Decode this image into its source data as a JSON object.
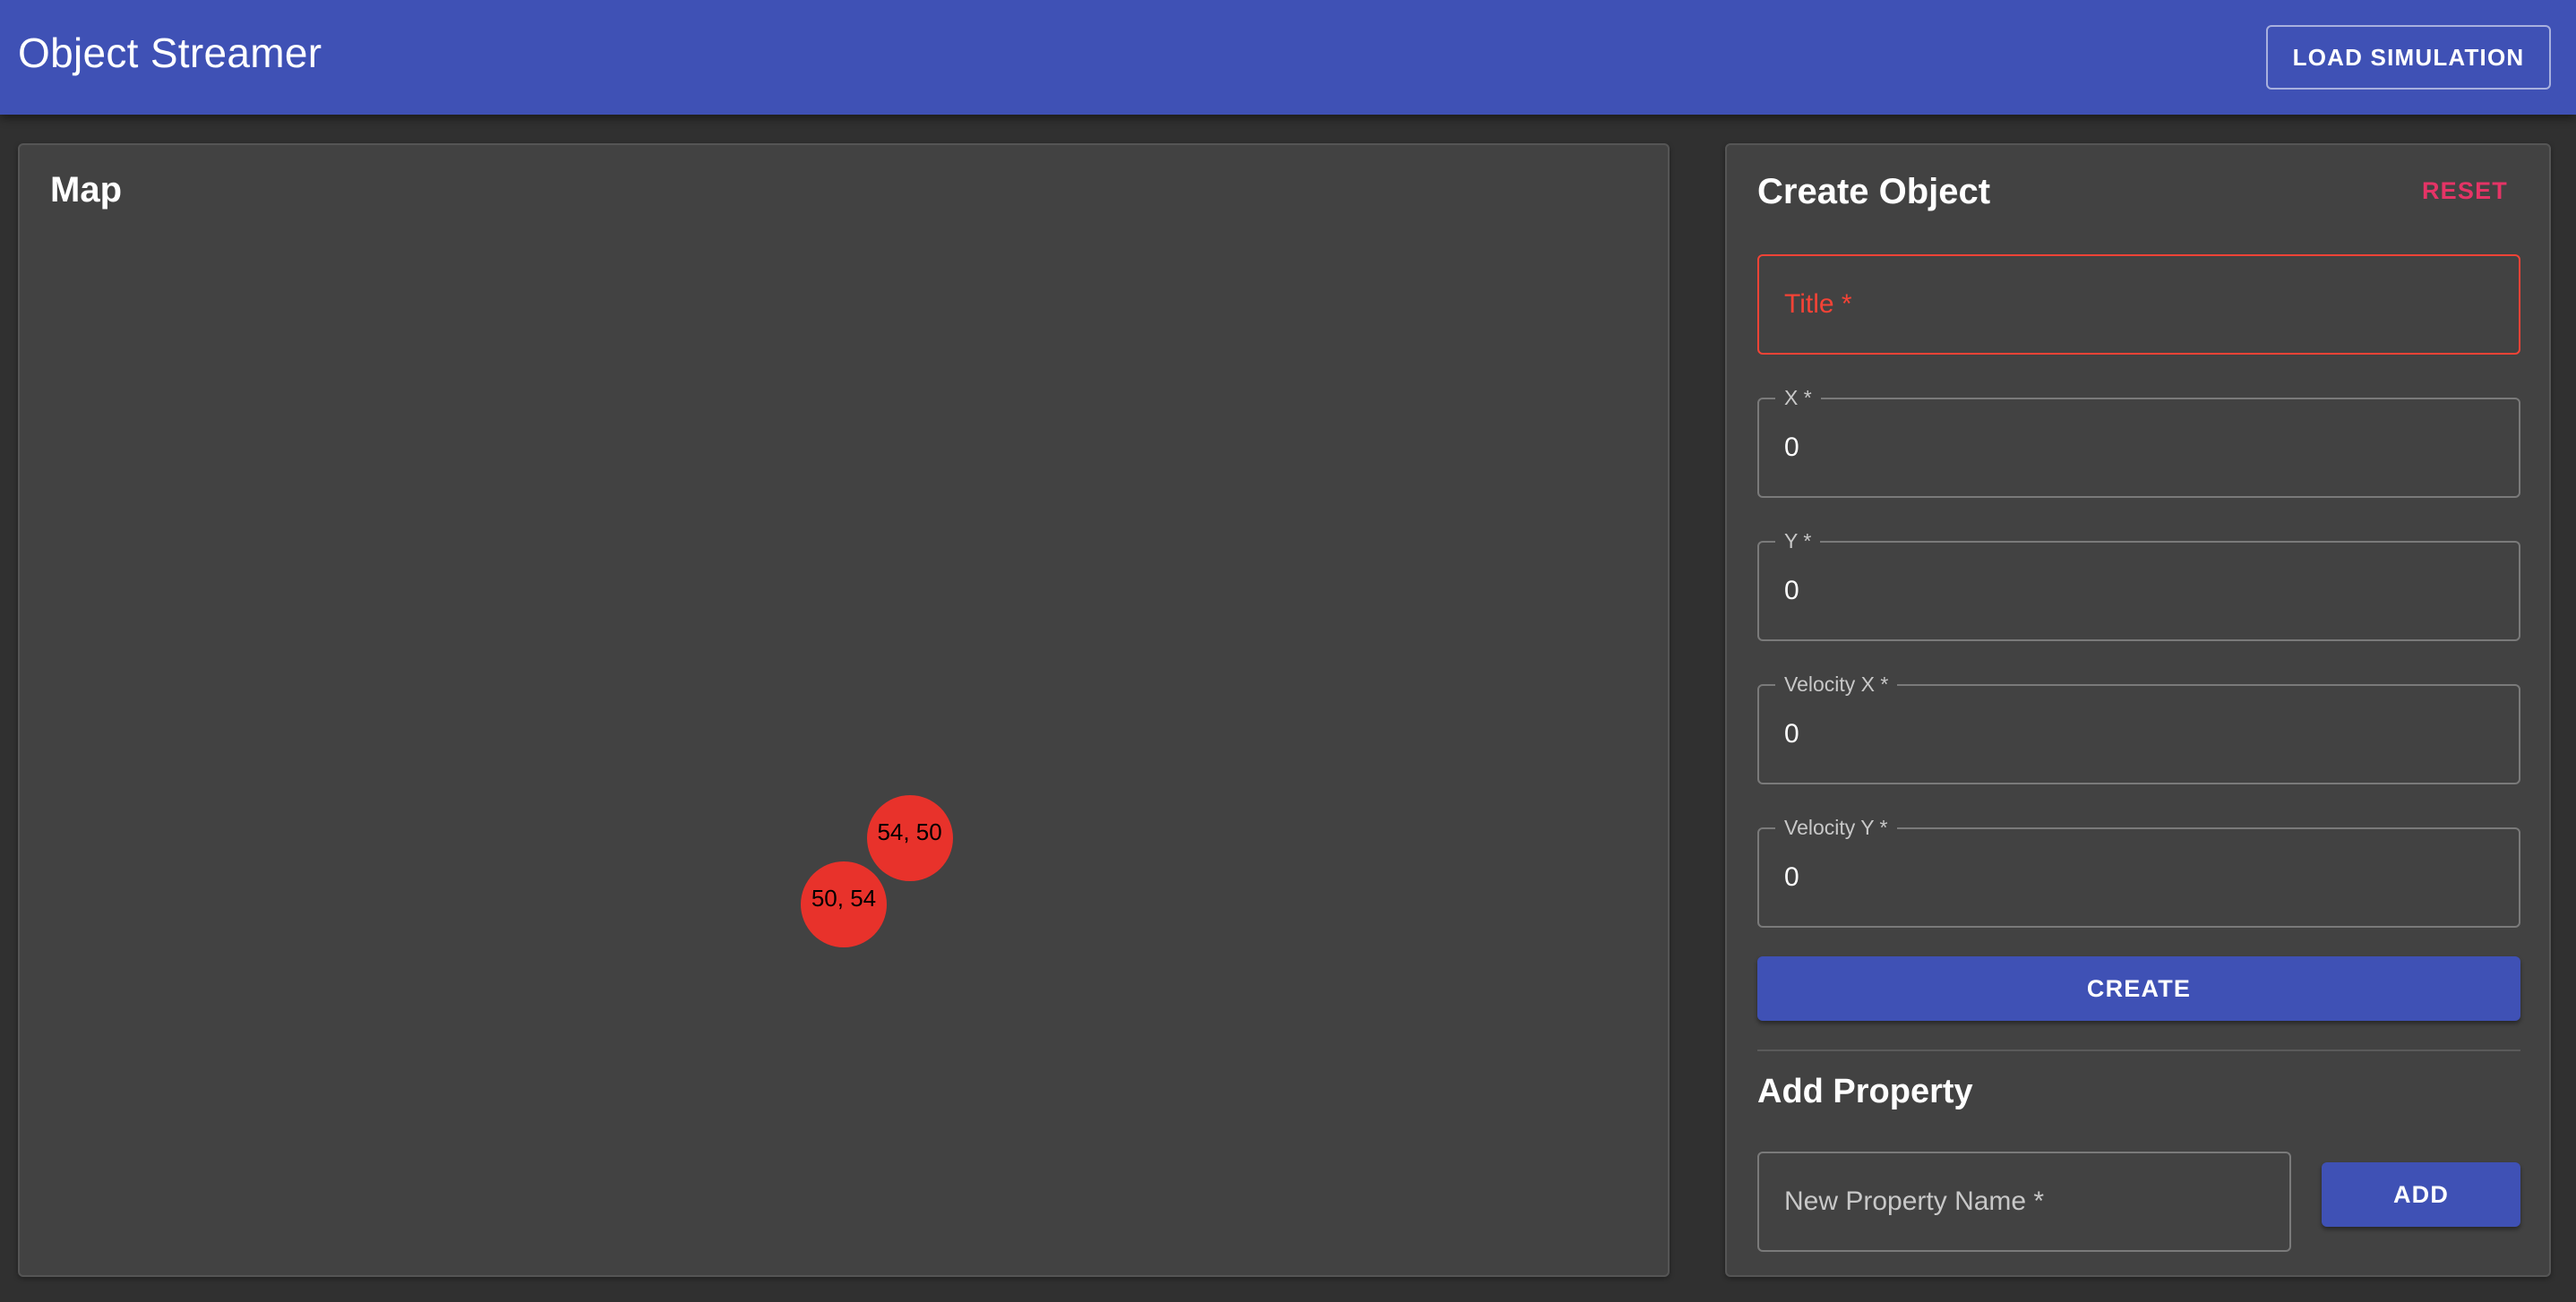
{
  "app_bar": {
    "title": "Object Streamer",
    "load_button_label": "LOAD SIMULATION",
    "color": "#3f51b5"
  },
  "map": {
    "title": "Map",
    "objects": [
      {
        "label": "54, 50",
        "x": 54,
        "y": 50,
        "color": "#e8322b"
      },
      {
        "label": "50, 54",
        "x": 50,
        "y": 54,
        "color": "#e8322b"
      }
    ]
  },
  "create_object": {
    "title": "Create Object",
    "reset_label": "RESET",
    "fields": {
      "title": {
        "placeholder": "Title *",
        "value": "",
        "error": true
      },
      "x": {
        "label": "X *",
        "value": "0"
      },
      "y": {
        "label": "Y *",
        "value": "0"
      },
      "velocity_x": {
        "label": "Velocity X *",
        "value": "0"
      },
      "velocity_y": {
        "label": "Velocity Y *",
        "value": "0"
      }
    },
    "create_label": "CREATE"
  },
  "add_property": {
    "title": "Add Property",
    "name_field": {
      "placeholder": "New Property Name *",
      "value": ""
    },
    "add_label": "ADD"
  },
  "colors": {
    "primary": "#3f51b5",
    "secondary": "#e53466",
    "error": "#f44336",
    "panel": "#424242",
    "background": "#303030"
  }
}
